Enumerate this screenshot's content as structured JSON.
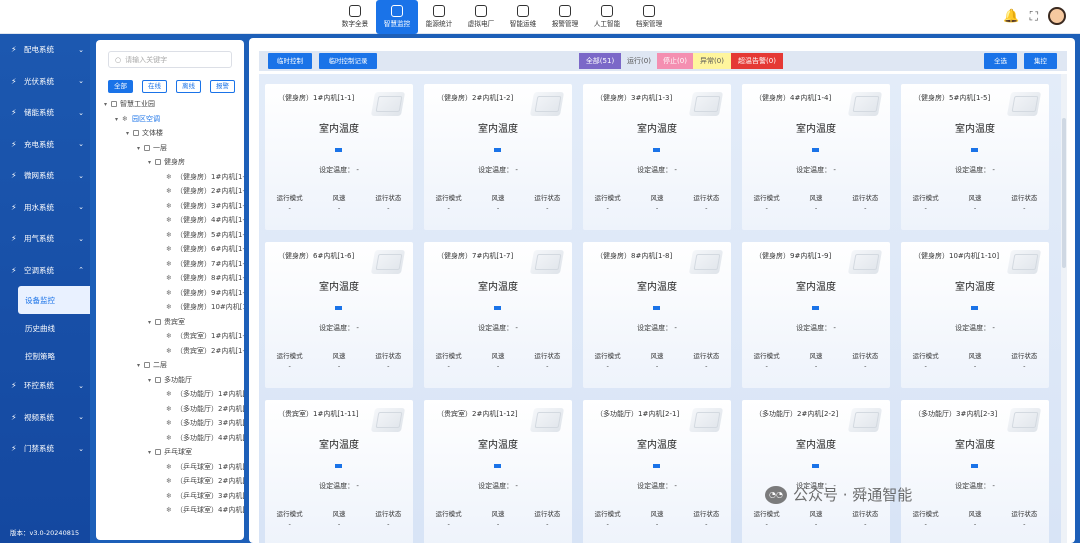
{
  "topnav": {
    "items": [
      {
        "label": "数字全景",
        "icon": "dashboard-icon"
      },
      {
        "label": "智慧监控",
        "icon": "monitor-icon",
        "active": true
      },
      {
        "label": "能源统计",
        "icon": "energy-icon"
      },
      {
        "label": "虚拟电厂",
        "icon": "plant-icon"
      },
      {
        "label": "智能运维",
        "icon": "gear-icon"
      },
      {
        "label": "报警管理",
        "icon": "alarm-icon"
      },
      {
        "label": "人工智能",
        "icon": "ai-icon"
      },
      {
        "label": "档案管理",
        "icon": "archive-icon"
      }
    ]
  },
  "sidebar": {
    "items": [
      {
        "label": "配电系统",
        "icon": "bolt-icon"
      },
      {
        "label": "光伏系统",
        "icon": "sun-icon"
      },
      {
        "label": "储能系统",
        "icon": "battery-icon"
      },
      {
        "label": "充电系统",
        "icon": "charger-icon"
      },
      {
        "label": "微网系统",
        "icon": "grid-icon"
      },
      {
        "label": "用水系统",
        "icon": "water-icon"
      },
      {
        "label": "用气系统",
        "icon": "flame-icon"
      },
      {
        "label": "空调系统",
        "icon": "aircon-icon"
      }
    ],
    "subitems": [
      "设备监控",
      "历史曲线",
      "控制策略"
    ],
    "items_after": [
      {
        "label": "环控系统",
        "icon": "env-icon"
      },
      {
        "label": "视频系统",
        "icon": "video-icon"
      },
      {
        "label": "门禁系统",
        "icon": "door-icon"
      }
    ],
    "version": "版本：v3.0-20240815"
  },
  "tree": {
    "search_placeholder": "请输入关键字",
    "filters": [
      "全部",
      "在线",
      "离线",
      "报警"
    ],
    "nodes": [
      {
        "label": "智慧工业园",
        "level": 0,
        "toggle": "▾",
        "type": "box"
      },
      {
        "label": "园区空调",
        "level": 1,
        "toggle": "▾",
        "type": "box",
        "selected": true
      },
      {
        "label": "文体楼",
        "level": 2,
        "toggle": "▾",
        "type": "box"
      },
      {
        "label": "一层",
        "level": 3,
        "toggle": "▾",
        "type": "box"
      },
      {
        "label": "健身房",
        "level": 4,
        "toggle": "▾",
        "type": "box"
      },
      {
        "label": "（健身房）1#内机[1-1]",
        "level": 5,
        "type": "dev"
      },
      {
        "label": "（健身房）2#内机[1-2]",
        "level": 5,
        "type": "dev"
      },
      {
        "label": "（健身房）3#内机[1-3]",
        "level": 5,
        "type": "dev"
      },
      {
        "label": "（健身房）4#内机[1-4]",
        "level": 5,
        "type": "dev"
      },
      {
        "label": "（健身房）5#内机[1-5]",
        "level": 5,
        "type": "dev"
      },
      {
        "label": "（健身房）6#内机[1-6]",
        "level": 5,
        "type": "dev"
      },
      {
        "label": "（健身房）7#内机[1-7]",
        "level": 5,
        "type": "dev"
      },
      {
        "label": "（健身房）8#内机[1-8]",
        "level": 5,
        "type": "dev"
      },
      {
        "label": "（健身房）9#内机[1-9]",
        "level": 5,
        "type": "dev"
      },
      {
        "label": "（健身房）10#内机[1-10]",
        "level": 5,
        "type": "dev"
      },
      {
        "label": "贵宾室",
        "level": 4,
        "toggle": "▾",
        "type": "box"
      },
      {
        "label": "（贵宾室）1#内机[1-11]",
        "level": 5,
        "type": "dev"
      },
      {
        "label": "（贵宾室）2#内机[1-12]",
        "level": 5,
        "type": "dev"
      },
      {
        "label": "二层",
        "level": 3,
        "toggle": "▾",
        "type": "box"
      },
      {
        "label": "多功能厅",
        "level": 4,
        "toggle": "▾",
        "type": "box"
      },
      {
        "label": "（多功能厅）1#内机[2-1]",
        "level": 5,
        "type": "dev"
      },
      {
        "label": "（多功能厅）2#内机[2-2]",
        "level": 5,
        "type": "dev"
      },
      {
        "label": "（多功能厅）3#内机[2-3]",
        "level": 5,
        "type": "dev"
      },
      {
        "label": "（多功能厅）4#内机[2-4]",
        "level": 5,
        "type": "dev"
      },
      {
        "label": "乒乓球室",
        "level": 4,
        "toggle": "▾",
        "type": "box"
      },
      {
        "label": "（乒乓球室）1#内机[2-5]",
        "level": 5,
        "type": "dev"
      },
      {
        "label": "（乒乓球室）2#内机[2-6]",
        "level": 5,
        "type": "dev"
      },
      {
        "label": "（乒乓球室）3#内机[2-7]",
        "level": 5,
        "type": "dev"
      },
      {
        "label": "（乒乓球室）4#内机[2-8]",
        "level": 5,
        "type": "dev"
      }
    ]
  },
  "toolbar": {
    "temp_control": "临时控制",
    "temp_control_log": "临时控制记录",
    "status_all": "全部(51)",
    "status_running": "运行(0)",
    "status_stopped": "停止(0)",
    "status_abnormal": "异常(0)",
    "status_overtemp": "超温告警(0)",
    "select_all": "全选",
    "group_control": "集控",
    "colors": {
      "all": "#7b68c8",
      "running": "#dfe7f3",
      "stopped": "#f48fb1",
      "abnormal": "#fff59d",
      "overtemp": "#e53935",
      "primary": "#1a73e8"
    }
  },
  "card_labels": {
    "title": "室内温度",
    "set_temp": "设定温度： -",
    "mode": "运行模式",
    "fan": "风速",
    "state": "运行状态",
    "empty": "-"
  },
  "cards": [
    {
      "name": "（健身房）1#内机[1-1]"
    },
    {
      "name": "（健身房）2#内机[1-2]"
    },
    {
      "name": "（健身房）3#内机[1-3]"
    },
    {
      "name": "（健身房）4#内机[1-4]"
    },
    {
      "name": "（健身房）5#内机[1-5]"
    },
    {
      "name": "（健身房）6#内机[1-6]"
    },
    {
      "name": "（健身房）7#内机[1-7]"
    },
    {
      "name": "（健身房）8#内机[1-8]"
    },
    {
      "name": "（健身房）9#内机[1-9]"
    },
    {
      "name": "（健身房）10#内机[1-10]"
    },
    {
      "name": "（贵宾室）1#内机[1-11]"
    },
    {
      "name": "（贵宾室）2#内机[1-12]"
    },
    {
      "name": "（多功能厅）1#内机[2-1]"
    },
    {
      "name": "（多功能厅）2#内机[2-2]"
    },
    {
      "name": "（多功能厅）3#内机[2-3]"
    }
  ],
  "watermark": "公众号 · 舜通智能"
}
